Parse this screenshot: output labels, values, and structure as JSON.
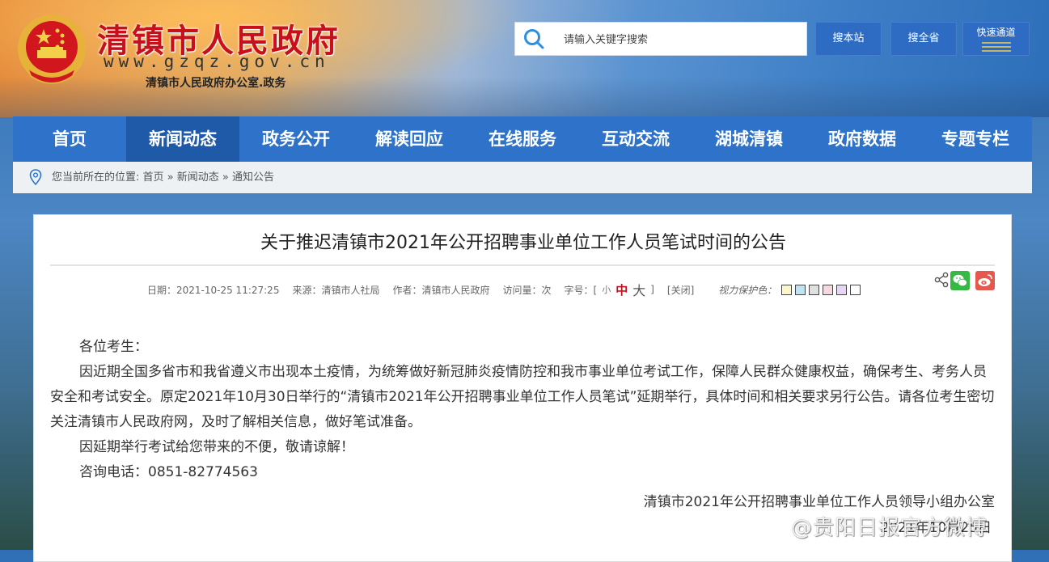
{
  "header": {
    "site_title": "清镇市人民政府",
    "site_domain": "www.gzqz.gov.cn",
    "site_subtitle": "清镇市人民政府办公室.政务",
    "search_placeholder": "请输入关键字搜索",
    "search_site_label": "搜本站",
    "search_province_label": "搜全省",
    "quick_access_label": "快速通道"
  },
  "nav": {
    "items": [
      {
        "label": "首页"
      },
      {
        "label": "新闻动态"
      },
      {
        "label": "政务公开"
      },
      {
        "label": "解读回应"
      },
      {
        "label": "在线服务"
      },
      {
        "label": "互动交流"
      },
      {
        "label": "湖城清镇"
      },
      {
        "label": "政府数据"
      },
      {
        "label": "专题专栏"
      }
    ],
    "active_index": 1
  },
  "breadcrumb": {
    "text": "您当前所在的位置: 首页 » 新闻动态 » 通知公告"
  },
  "article": {
    "title": "关于推迟清镇市2021年公开招聘事业单位工作人员笔试时间的公告",
    "meta": {
      "date": "日期：2021-10-25 11:27:25",
      "source": "来源：清镇市人社局",
      "author": "作者：清镇市人民政府",
      "views": "访问量：次",
      "font_size_label": "字号：[",
      "font_small": "小",
      "font_mid": "中",
      "font_big": "大",
      "font_close_bracket": "]",
      "close": "[关闭]",
      "vision_label": "视力保护色："
    },
    "swatch_colors": [
      "#fbf7c6",
      "#bfe3f0",
      "#e0e0e0",
      "#f5d8e0",
      "#e6d6f5",
      "#ffffff"
    ],
    "greeting": "各位考生：",
    "paragraph1": "因近期全国多省市和我省遵义市出现本土疫情，为统筹做好新冠肺炎疫情防控和我市事业单位考试工作，保障人民群众健康权益，确保考生、考务人员安全和考试安全。原定2021年10月30日举行的“清镇市2021年公开招聘事业单位工作人员笔试”延期举行，具体时间和相关要求另行公告。请各位考生密切关注清镇市人民政府网，及时了解相关信息，做好笔试准备。",
    "paragraph2": "因延期举行考试给您带来的不便，敬请谅解！",
    "contact": "咨询电话：0851-82774563",
    "signature": "清镇市2021年公开招聘事业单位工作人员领导小组办公室",
    "sign_date": "2021年10月25日"
  },
  "watermark": {
    "text": "@贵阳日报官方微博"
  },
  "colors": {
    "nav_bg": "#2e73c9",
    "nav_active": "#1f5aa8",
    "title_red": "#c8101b",
    "button_blue": "#2e6cc3"
  }
}
